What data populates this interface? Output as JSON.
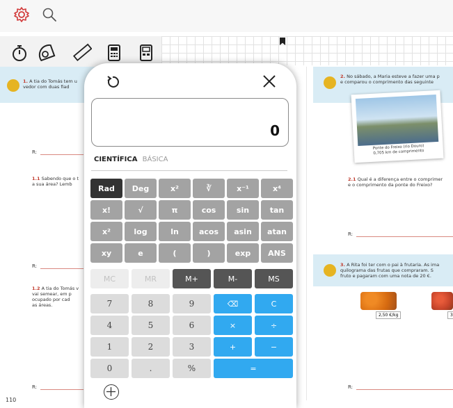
{
  "book": {
    "q1": {
      "num": "1.",
      "text": "A tia do Tomás tem u",
      "text2": "vedor com duas fiad"
    },
    "q1_1": {
      "num": "1.1",
      "text": "Sabendo que o t",
      "text2": "a sua área? Lemb"
    },
    "q1_2": {
      "num": "1.2",
      "text": "A tia do Tomás v",
      "text2": "vai semear, em p",
      "text3": "ocupado por cad",
      "text4": "as áreas."
    },
    "q2": {
      "num": "2.",
      "text": "No sábado, a Maria esteve a fazer uma p",
      "text2": "e comparou o comprimento das seguinte"
    },
    "q2_1": {
      "num": "2.1",
      "text": "Qual é a diferença entre o comprimer",
      "text2": "e o comprimento da ponte do Freixo?"
    },
    "q3": {
      "num": "3.",
      "text": "A Rita foi ter com o pai à frutaria. As ima",
      "text2": "quilograma das frutas que compraram. S",
      "text3": "fruto e pagaram com uma nota de 20 €."
    },
    "photo_caption": "Ponte do Freixo (rio Douro)",
    "photo_caption2": "0,705 km de comprimento",
    "price": "2,50 €/kg",
    "price2": "3,",
    "r_label": "R:",
    "page_number": "110"
  },
  "calculator": {
    "display_value": "0",
    "mode_active": "CIENTÍFICA",
    "mode_inactive": "BÁSICA",
    "rows": [
      [
        {
          "l": "Rad",
          "s": "kd"
        },
        {
          "l": "Deg",
          "s": "kg"
        },
        {
          "l": "x²",
          "s": "kg"
        },
        {
          "l": "∛",
          "s": "kg"
        },
        {
          "l": "x⁻¹",
          "s": "kg"
        },
        {
          "l": "x⁴",
          "s": "kg"
        }
      ],
      [
        {
          "l": "x!",
          "s": "kg"
        },
        {
          "l": "√",
          "s": "kg"
        },
        {
          "l": "π",
          "s": "kg"
        },
        {
          "l": "cos",
          "s": "kg"
        },
        {
          "l": "sin",
          "s": "kg"
        },
        {
          "l": "tan",
          "s": "kg"
        }
      ],
      [
        {
          "l": "x²",
          "s": "kg"
        },
        {
          "l": "log",
          "s": "kg"
        },
        {
          "l": "ln",
          "s": "kg"
        },
        {
          "l": "acos",
          "s": "kg"
        },
        {
          "l": "asin",
          "s": "kg"
        },
        {
          "l": "atan",
          "s": "kg"
        }
      ],
      [
        {
          "l": "xy",
          "s": "kg"
        },
        {
          "l": "e",
          "s": "kg"
        },
        {
          "l": "(",
          "s": "kg"
        },
        {
          "l": ")",
          "s": "kg"
        },
        {
          "l": "exp",
          "s": "kg"
        },
        {
          "l": "ANS",
          "s": "kg"
        }
      ]
    ],
    "memory": [
      {
        "l": "MC",
        "s": "kl"
      },
      {
        "l": "MR",
        "s": "kl"
      },
      {
        "l": "M+",
        "s": "km"
      },
      {
        "l": "M-",
        "s": "km"
      },
      {
        "l": "MS",
        "s": "km"
      }
    ],
    "pad": [
      [
        {
          "l": "7",
          "s": "kn"
        },
        {
          "l": "8",
          "s": "kn"
        },
        {
          "l": "9",
          "s": "kn"
        },
        {
          "l": "⌫",
          "s": "kb"
        },
        {
          "l": "C",
          "s": "kb"
        }
      ],
      [
        {
          "l": "4",
          "s": "kn"
        },
        {
          "l": "5",
          "s": "kn"
        },
        {
          "l": "6",
          "s": "kn"
        },
        {
          "l": "×",
          "s": "kb"
        },
        {
          "l": "÷",
          "s": "kb"
        }
      ],
      [
        {
          "l": "1",
          "s": "kn"
        },
        {
          "l": "2",
          "s": "kn"
        },
        {
          "l": "3",
          "s": "kn"
        },
        {
          "l": "+",
          "s": "kb"
        },
        {
          "l": "−",
          "s": "kb"
        }
      ],
      [
        {
          "l": "0",
          "s": "kn"
        },
        {
          "l": ".",
          "s": "kn"
        },
        {
          "l": "%",
          "s": "kn"
        },
        {
          "l": "=",
          "s": "kb"
        }
      ]
    ]
  },
  "colors": {
    "accent_red": "#d23a3a",
    "key_blue": "#31a9f0"
  },
  "icons": [
    "gear-icon",
    "search-icon",
    "stopwatch-icon",
    "protractor-icon",
    "ruler-icon",
    "calculator-icon",
    "basic-calculator-icon",
    "undo-icon",
    "close-icon",
    "move-icon",
    "bookmark-icon"
  ]
}
